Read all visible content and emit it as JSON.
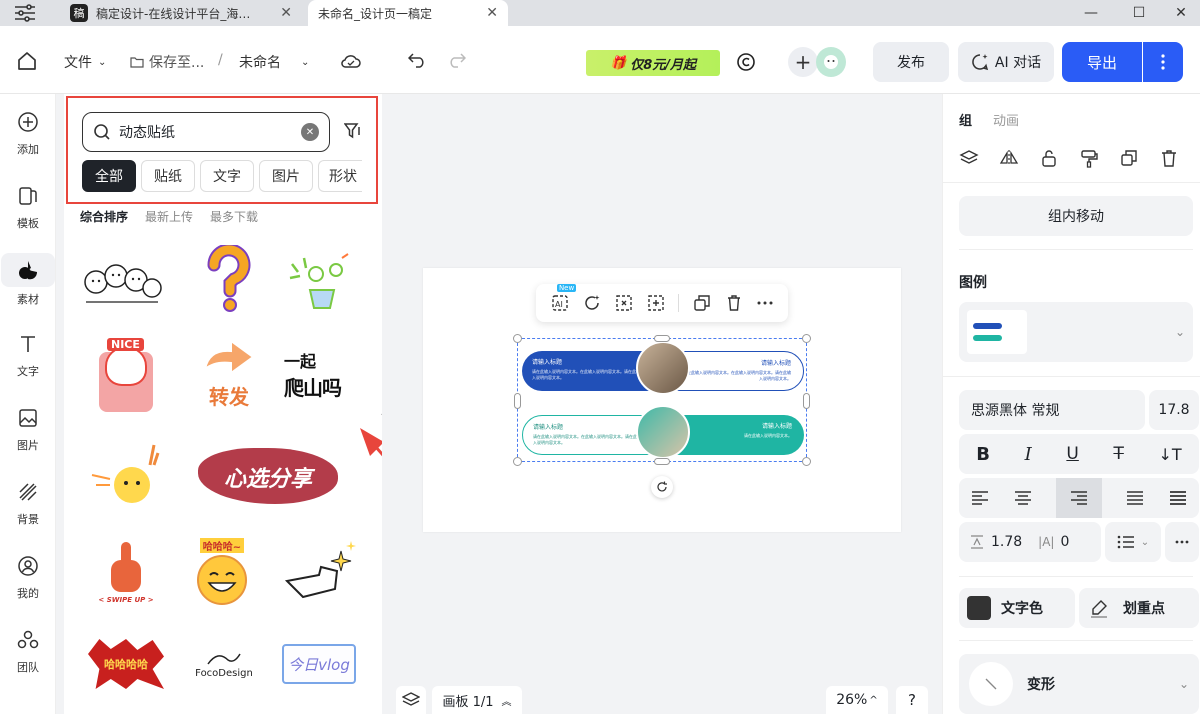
{
  "tabs": {
    "tab1": "稿定设计-在线设计平台_海…",
    "tab2": "未命名_设计页一稿定"
  },
  "toolbar": {
    "file": "文件",
    "save_to": "保存至...",
    "separator": "/",
    "doc_name": "未命名",
    "promo": "仅8元/月起",
    "publish": "发布",
    "ai_chat": "AI 对话",
    "export": "导出"
  },
  "rail": [
    {
      "label": "添加",
      "icon": "plus-circle-icon"
    },
    {
      "label": "模板",
      "icon": "template-icon"
    },
    {
      "label": "素材",
      "icon": "material-icon"
    },
    {
      "label": "文字",
      "icon": "text-icon"
    },
    {
      "label": "图片",
      "icon": "image-icon"
    },
    {
      "label": "背景",
      "icon": "background-icon"
    },
    {
      "label": "我的",
      "icon": "user-icon"
    },
    {
      "label": "团队",
      "icon": "team-icon"
    }
  ],
  "panel": {
    "search_value": "动态贴纸",
    "chips": [
      "全部",
      "贴纸",
      "文字",
      "图片",
      "形状"
    ],
    "sorts": [
      "综合排序",
      "最新上传",
      "最多下载"
    ],
    "stickers": {
      "nice": "NICE",
      "forward": "转发",
      "climb_1": "一起",
      "climb_2": "爬山吗",
      "share": "心选分享",
      "swipe": "< SWIPE UP >",
      "haha": "哈哈哈~",
      "boom": "哈哈哈哈",
      "foco": "FocoDesign",
      "vlog": "今日vlog",
      "new_badge": "New"
    }
  },
  "canvas": {
    "card_title": "请输入标题",
    "card_body": "请在此输入说明内容文本。在此输入说明内容文本。请在此输入说明内容文本。",
    "card_body_short": "请在此输入说明内容文本。",
    "board": "画板 1/1",
    "zoom": "26%",
    "help": "?"
  },
  "right": {
    "tab_group": "组",
    "tab_anim": "动画",
    "move_in_group": "组内移动",
    "legend": "图例",
    "font_name": "思源黑体 常规",
    "font_size": "17.8",
    "line_height": "1.78",
    "letter_spacing": "0",
    "text_color": "文字色",
    "highlight": "划重点",
    "transform": "变形"
  }
}
